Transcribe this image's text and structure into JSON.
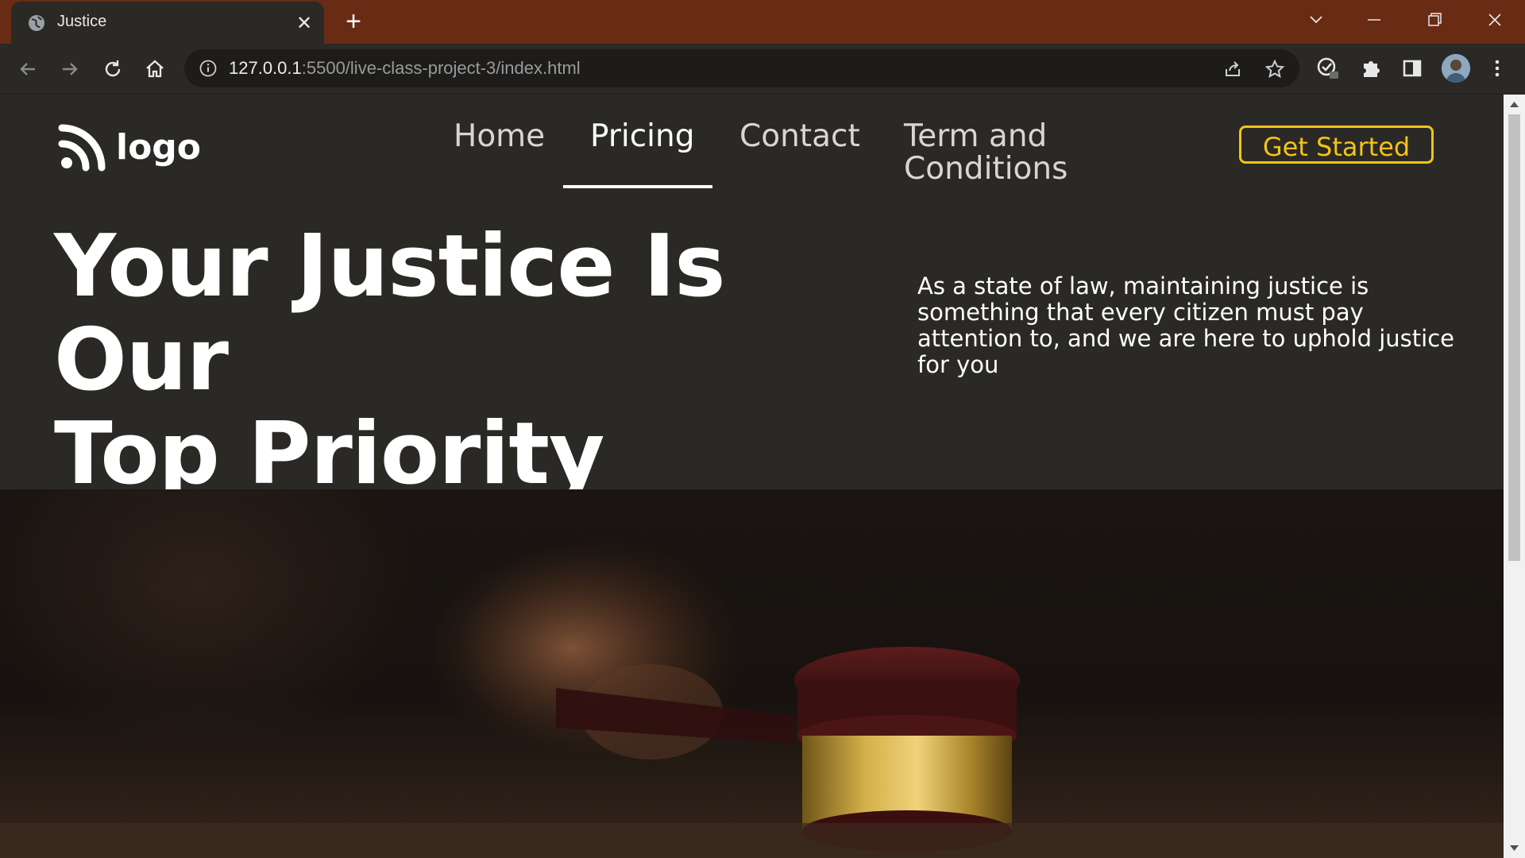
{
  "browser": {
    "tab_title": "Justice",
    "url_host": "127.0.0.1",
    "url_path": ":5500/live-class-project-3/index.html"
  },
  "site": {
    "logo_text": "logo",
    "nav": [
      {
        "label": "Home"
      },
      {
        "label": "Pricing",
        "active": true
      },
      {
        "label": "Contact"
      },
      {
        "label": "Term and Conditions"
      }
    ],
    "cta_label": "Get Started",
    "hero": {
      "title_line1": "Your Justice Is Our",
      "title_line2": "Top Priority",
      "description": "As a state of law, maintaining justice is something that every citizen must pay attention to, and we are here to uphold justice for you"
    },
    "colors": {
      "accent": "#f2c418",
      "page_bg": "#2b2925",
      "tabbar_bg": "#6a2b14"
    },
    "icons": {
      "logo": "rss-feed-icon",
      "hero_image": "gavel-image"
    }
  }
}
